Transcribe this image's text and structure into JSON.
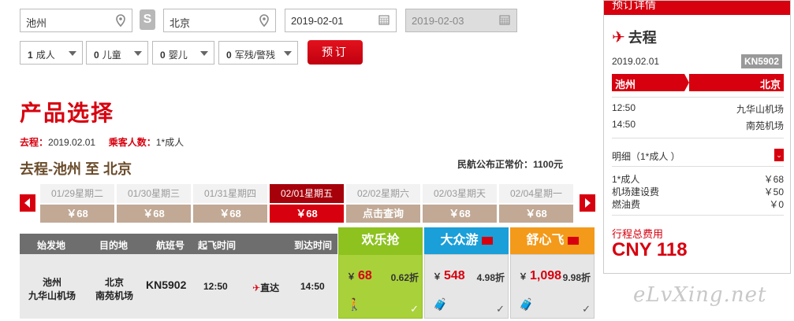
{
  "search": {
    "from_city": "池州",
    "to_city": "北京",
    "depart_date": "2019-02-01",
    "return_date": "2019-02-03",
    "swap_label": "S"
  },
  "passengers": {
    "adult_count": "1",
    "adult_label": "成人",
    "child_count": "0",
    "child_label": "儿童",
    "infant_count": "0",
    "infant_label": "婴儿",
    "disabled_count": "0",
    "disabled_label": "军残/警残",
    "book_label": "预订"
  },
  "product": {
    "title": "产品选择",
    "outbound_label": "去程：",
    "outbound_date": "2019.02.01",
    "pax_label": "乘客人数：",
    "pax_value": "1*成人",
    "route_title": "去程-池州 至 北京",
    "public_price": "民航公布正常价：1100元"
  },
  "date_strip": [
    {
      "date": "01/29星期二",
      "price": "￥68"
    },
    {
      "date": "01/30星期三",
      "price": "￥68"
    },
    {
      "date": "01/31星期四",
      "price": "￥68"
    },
    {
      "date": "02/01星期五",
      "price": "￥68"
    },
    {
      "date": "02/02星期六",
      "price": "点击查询"
    },
    {
      "date": "02/03星期天",
      "price": "￥68"
    },
    {
      "date": "02/04星期一",
      "price": "￥68"
    }
  ],
  "table": {
    "headers": [
      "始发地",
      "目的地",
      "航班号",
      "起飞时间",
      "到达时间"
    ],
    "row": {
      "origin_city": "池州",
      "origin_airport": "九华山机场",
      "dest_city": "北京",
      "dest_airport": "南苑机场",
      "flight": "KN5902",
      "depart_time": "12:50",
      "direct_label": "直达",
      "arrive_time": "14:50"
    }
  },
  "fares": [
    {
      "name": "欢乐抢",
      "yen": "￥",
      "price": "68",
      "discount": "0.62折",
      "color": "#8dc21f"
    },
    {
      "name": "大众游",
      "yen": "￥",
      "price": "548",
      "discount": "4.98折",
      "color": "#1a9fd9"
    },
    {
      "name": "舒心飞",
      "yen": "￥",
      "price": "1,098",
      "discount": "9.98折",
      "color": "#f39a1a"
    }
  ],
  "panel": {
    "header": "预订详情",
    "go_label": "去程",
    "date": "2019.02.01",
    "flight": "KN5902",
    "from": "池州",
    "to": "北京",
    "dep_time": "12:50",
    "dep_airport": "九华山机场",
    "arr_time": "14:50",
    "arr_airport": "南苑机场",
    "detail_label": "明细（1*成人 ）",
    "lines": [
      {
        "label": "1*成人",
        "value": "￥68"
      },
      {
        "label": "机场建设费",
        "value": "￥50"
      },
      {
        "label": "燃油费",
        "value": "￥0"
      }
    ],
    "total_label": "行程总费用",
    "total_value": "CNY 118"
  },
  "watermark": "eLvXing.net",
  "colors": {
    "brand_red": "#d7000f",
    "date_price_bg": "#c1a996",
    "route_brown": "#6a4c2b"
  }
}
